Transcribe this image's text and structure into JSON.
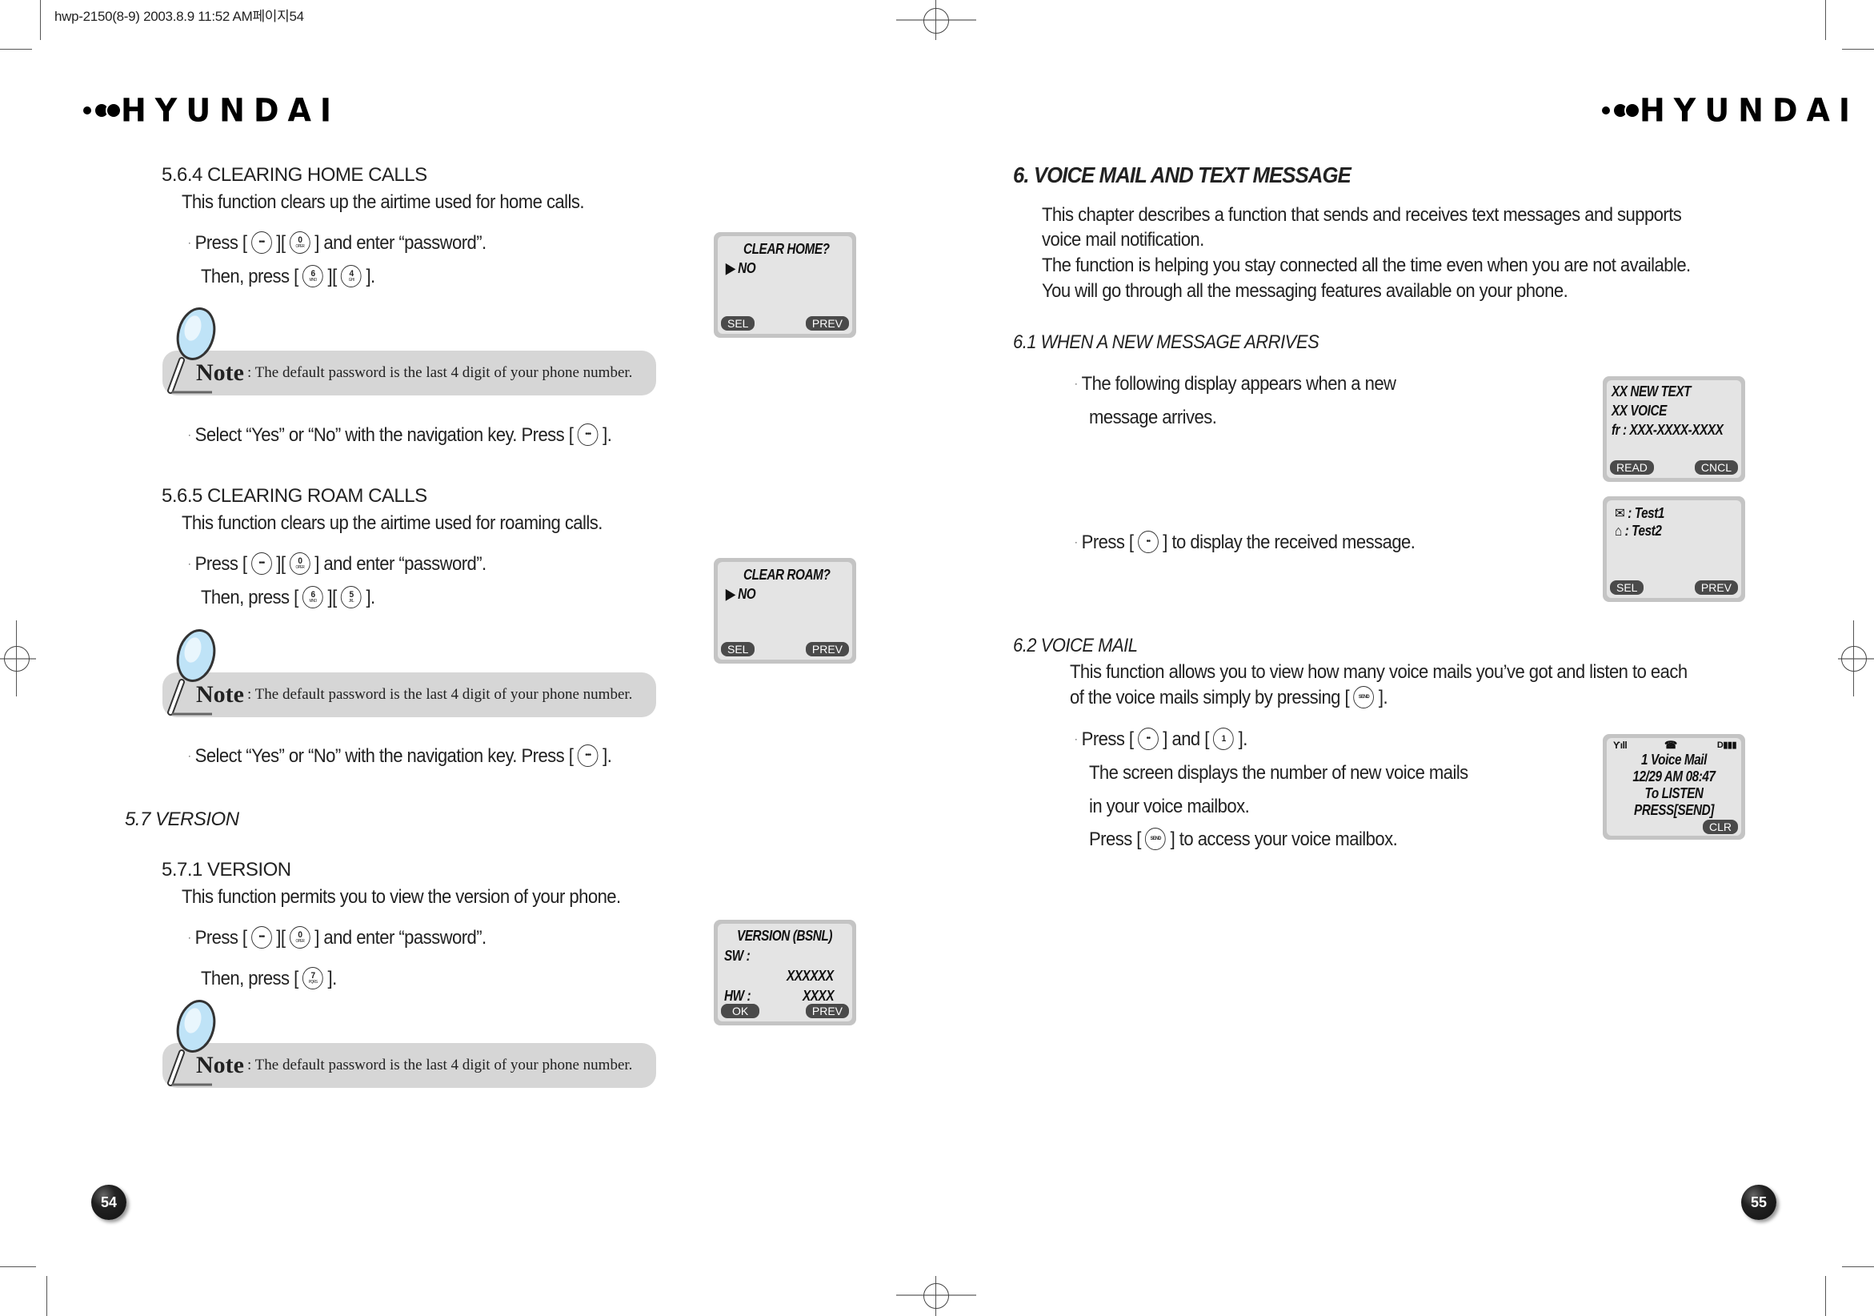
{
  "print_meta": "hwp-2150(8-9)  2003.8.9 11:52 AM페이지54",
  "brand": "HYUNDAI",
  "left_page": {
    "page_number": "54",
    "section_564": {
      "heading": "5.6.4 CLEARING HOME CALLS",
      "description": "This function clears up the airtime used for home calls.",
      "step1": {
        "pre": "Press [",
        "mid": "][",
        "post": "] and enter “password”.",
        "keys": [
          {
            "main": "•••",
            "sub": ""
          },
          {
            "main": "0",
            "sub": "OPER"
          }
        ]
      },
      "step2": {
        "pre": "Then, press [",
        "mid": "][",
        "post": "].",
        "keys": [
          {
            "main": "6",
            "sub": "MNO"
          },
          {
            "main": "4",
            "sub": "GHI"
          }
        ]
      },
      "note": {
        "label": "Note",
        "text": ": The default password is the last 4 digit of your phone number."
      },
      "step3": {
        "pre": "Select “Yes” or “No” with the navigation key. Press [",
        "post": "].",
        "key": {
          "main": "•••"
        }
      },
      "lcd": {
        "title": "CLEAR HOME?",
        "option": "NO",
        "left_soft": "SEL",
        "right_soft": "PREV"
      }
    },
    "section_565": {
      "heading": "5.6.5 CLEARING ROAM CALLS",
      "description": "This function clears up the airtime used for roaming calls.",
      "step1": {
        "pre": "Press [",
        "mid": "][",
        "post": "] and enter “password”.",
        "keys": [
          {
            "main": "•••",
            "sub": ""
          },
          {
            "main": "0",
            "sub": "OPER"
          }
        ]
      },
      "step2": {
        "pre": "Then, press [",
        "mid": "][",
        "post": "].",
        "keys": [
          {
            "main": "6",
            "sub": "MNO"
          },
          {
            "main": "5",
            "sub": "JKL"
          }
        ]
      },
      "note": {
        "label": "Note",
        "text": ": The default password is the last 4 digit of your phone number."
      },
      "step3": {
        "pre": "Select “Yes” or “No” with the navigation key. Press [",
        "post": "].",
        "key": {
          "main": "•••"
        }
      },
      "lcd": {
        "title": "CLEAR ROAM?",
        "option": "NO",
        "left_soft": "SEL",
        "right_soft": "PREV"
      }
    },
    "section_57": {
      "heading": "5.7 VERSION",
      "sub_heading": "5.7.1 VERSION",
      "description": "This function permits you to view the version of your phone.",
      "step1": {
        "pre": "Press [",
        "mid": "][",
        "post": "] and enter “password”.",
        "keys": [
          {
            "main": "•••",
            "sub": ""
          },
          {
            "main": "0",
            "sub": "OPER"
          }
        ]
      },
      "step2": {
        "pre": "Then, press [",
        "post": "].",
        "key": {
          "main": "7",
          "sub": "PQRS"
        }
      },
      "note": {
        "label": "Note",
        "text": ": The default password is the last 4 digit of your phone number."
      },
      "lcd": {
        "title": "VERSION (BSNL)",
        "sw_label": "SW :",
        "sw_value": "XXXXXX",
        "hw_label": "HW :",
        "hw_value": "XXXX",
        "left_soft": "OK",
        "right_soft": "PREV"
      }
    }
  },
  "right_page": {
    "page_number": "55",
    "chapter_title": "6. VOICE MAIL AND TEXT MESSAGE",
    "intro": [
      "This chapter describes a function that sends and receives text messages and supports",
      "voice mail notification.",
      "The function is helping you stay connected all the time even when you are not available.",
      "You will go through all the messaging features available on your phone."
    ],
    "section_61": {
      "heading": "6.1 WHEN A NEW MESSAGE ARRIVES",
      "bullet1_line1": "The following display appears when a new",
      "bullet1_line2": "message arrives.",
      "bullet2": {
        "pre": "Press [",
        "post": "] to display the received message.",
        "key": {
          "main": "••"
        }
      },
      "lcd1": {
        "line1": "XX  NEW TEXT",
        "line2": "XX  VOICE",
        "line3": "fr : XXX-XXXX-XXXX",
        "left_soft": "READ",
        "right_soft": "CNCL"
      },
      "lcd2": {
        "msg1": ": Test1",
        "msg2": ": Test2",
        "left_soft": "SEL",
        "right_soft": "PREV"
      }
    },
    "section_62": {
      "heading": "6.2 VOICE MAIL",
      "desc_line1": "This function allows you to view how many voice mails you’ve got and listen to each",
      "desc_line2_pre": "of the voice mails simply by pressing [",
      "desc_line2_post": "].",
      "send_key": "SEND",
      "step1": {
        "pre": "Press [",
        "mid": "] and [",
        "post": "].",
        "keys": [
          {
            "main": "••"
          },
          {
            "main": "1"
          }
        ]
      },
      "step2_line1": "The screen displays the number of new voice mails",
      "step2_line2": "in your voice mailbox.",
      "step3": {
        "pre": "Press [",
        "post": "] to access your voice mailbox."
      },
      "lcd": {
        "line1": "1 Voice Mail",
        "line2": "12/29 AM 08:47",
        "line3": "To LISTEN",
        "line4": "PRESS[SEND]",
        "right_soft": "CLR"
      }
    }
  }
}
